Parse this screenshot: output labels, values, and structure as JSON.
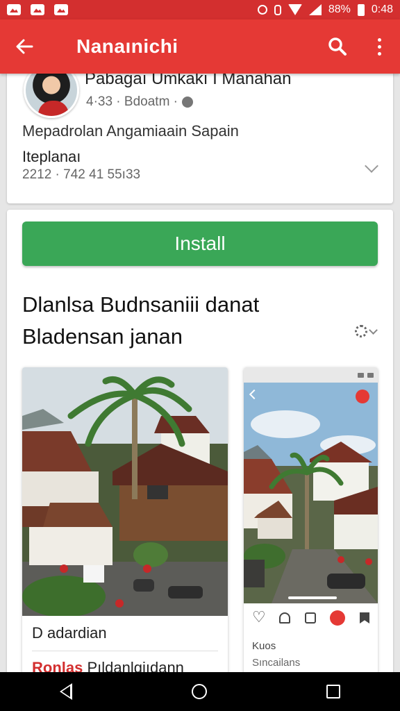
{
  "status_bar": {
    "battery_text": "88%",
    "time": "0:48",
    "notification_icons": [
      "gallery-icon",
      "gallery-icon",
      "gallery-icon"
    ],
    "system_icons": [
      "alarm-icon",
      "vibrate-icon",
      "wifi-icon",
      "signal-icon",
      "battery-icon"
    ]
  },
  "app_bar": {
    "title": "Nanaınichi",
    "back_icon": "arrow-left-icon",
    "actions": [
      "search-icon",
      "more-vert-icon"
    ]
  },
  "profile": {
    "name": "Pabagaı Umkakı I Manahan",
    "meta": "4·33 · Bdoatm ·",
    "description": "Mepadrolan Angamiaain  Sapain",
    "subtitle": "Iteplanaı",
    "phone": "2212 · 742 41 55ı33"
  },
  "install_label": "Install",
  "section": {
    "title": "Dlanlsa Budnsaniii danat Bladensan janan"
  },
  "tiles": {
    "first": {
      "caption": "D adardian",
      "link_highlight": "Ronlas",
      "link_text": " Pıldanlgiıdann"
    },
    "second": {
      "caption": "Kuos",
      "subtitle": "Sıncailans"
    }
  },
  "colors": {
    "primary": "#e53935",
    "status": "#d32f2f",
    "install": "#3aa757"
  },
  "nav": [
    "nav-back-icon",
    "nav-home-icon",
    "nav-recent-icon"
  ]
}
